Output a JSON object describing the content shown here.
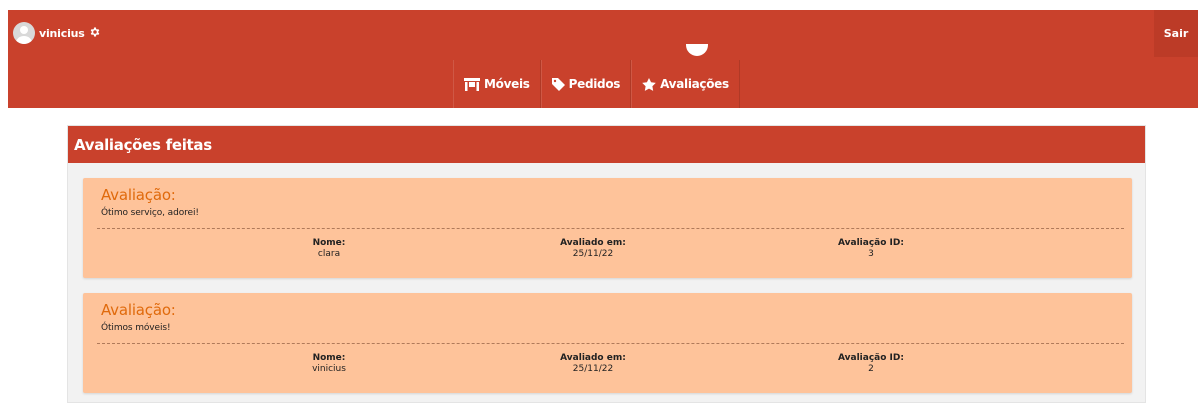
{
  "header": {
    "username": "vinicius",
    "logout_label": "Sair"
  },
  "nav": {
    "items": [
      {
        "label": "Móveis",
        "icon": "store-icon"
      },
      {
        "label": "Pedidos",
        "icon": "tag-icon"
      },
      {
        "label": "Avaliações",
        "icon": "star-icon"
      }
    ]
  },
  "panel": {
    "title": "Avaliações feitas"
  },
  "reviews": [
    {
      "heading": "Avaliação:",
      "text": "Ótimo serviço, adorei!",
      "name_label": "Nome:",
      "name": "clara",
      "date_label": "Avaliado em:",
      "date": "25/11/22",
      "id_label": "Avaliação ID:",
      "id": "3"
    },
    {
      "heading": "Avaliação:",
      "text": "Ótimos móveis!",
      "name_label": "Nome:",
      "name": "vinicius",
      "date_label": "Avaliado em:",
      "date": "25/11/22",
      "id_label": "Avaliação ID:",
      "id": "2"
    }
  ],
  "colors": {
    "brand": "#c9412c",
    "card": "#fec39a",
    "card_title": "#e06a0c"
  }
}
